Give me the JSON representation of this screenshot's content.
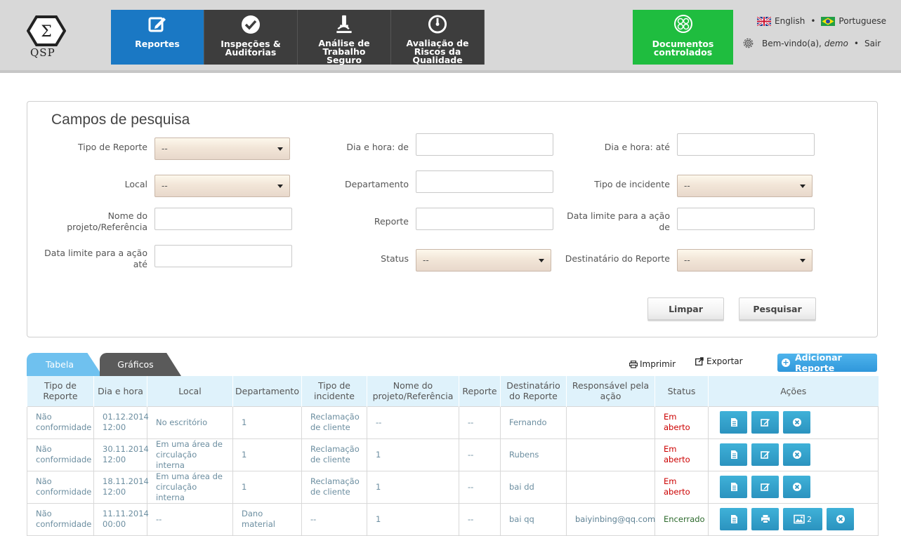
{
  "logo_text": "QSP",
  "nav": [
    {
      "label_1": "Reportes",
      "label_2": "",
      "label_3": "",
      "active": true,
      "icon": "edit-icon"
    },
    {
      "label_1": "Inspeções &",
      "label_2": "Auditorias",
      "label_3": "",
      "active": false,
      "icon": "check-circle-icon"
    },
    {
      "label_1": "Análise de",
      "label_2": "Trabalho",
      "label_3": "Seguro",
      "active": false,
      "icon": "microscope-icon"
    },
    {
      "label_1": "Avaliação de",
      "label_2": "Riscos da",
      "label_3": "Qualidade",
      "active": false,
      "icon": "gauge-icon"
    }
  ],
  "docs": {
    "line1": "Documentos",
    "line2": "controlados"
  },
  "lang": {
    "english": "English",
    "portuguese": "Portuguese",
    "dot": "•"
  },
  "user": {
    "welcome": "Bem-vindo(a),",
    "name": "demo",
    "logout": "Sair"
  },
  "search": {
    "title": "Campos de pesquisa",
    "tipo_reporte": "Tipo de Reporte",
    "dia_hora_de": "Dia e hora: de",
    "dia_hora_ate": "Dia e hora: até",
    "local": "Local",
    "departamento": "Departamento",
    "tipo_incidente": "Tipo de incidente",
    "nome_projeto_1": "Nome do",
    "nome_projeto_2": "projeto/Referência",
    "reporte": "Reporte",
    "data_limite_de_1": "Data limite para a ação",
    "data_limite_de_2": "de",
    "data_limite_ate_1": "Data limite para a ação",
    "data_limite_ate_2": "até",
    "status": "Status",
    "destinatario": "Destinatário do Reporte",
    "select_default": "--",
    "clear": "Limpar",
    "search": "Pesquisar"
  },
  "tabs": {
    "table": "Tabela",
    "charts": "Gráficos"
  },
  "toolbar": {
    "print": "Imprimir",
    "export": "Exportar",
    "add": "Adicionar Reporte"
  },
  "table": {
    "headers": [
      {
        "l1": "Tipo de",
        "l2": "Reporte"
      },
      {
        "l1": "Dia e hora",
        "l2": ""
      },
      {
        "l1": "Local",
        "l2": ""
      },
      {
        "l1": "Departamento",
        "l2": ""
      },
      {
        "l1": "Tipo de",
        "l2": "incidente"
      },
      {
        "l1": "Nome do",
        "l2": "projeto/Referência"
      },
      {
        "l1": "Reporte",
        "l2": ""
      },
      {
        "l1": "Destinatário",
        "l2": "do Reporte"
      },
      {
        "l1": "Responsável pela",
        "l2": "ação"
      },
      {
        "l1": "Status",
        "l2": ""
      },
      {
        "l1": "Ações",
        "l2": ""
      }
    ],
    "rows": [
      {
        "tipo_1": "Não",
        "tipo_2": "conformidade",
        "data_1": "01.12.2014",
        "data_2": "12:00",
        "local_1": "No escritório",
        "local_2": "",
        "dep": "1",
        "inc_1": "Reclamação",
        "inc_2": "de cliente",
        "proj": "--",
        "rep": "--",
        "dest": "Fernando",
        "resp": "",
        "status_1": "Em",
        "status_2": "aberto"
      },
      {
        "tipo_1": "Não",
        "tipo_2": "conformidade",
        "data_1": "30.11.2014",
        "data_2": "12:00",
        "local_1": "Em uma área de",
        "local_2": "circulação interna",
        "dep": "1",
        "inc_1": "Reclamação",
        "inc_2": "de cliente",
        "proj": "1",
        "rep": "--",
        "dest": "Rubens",
        "resp": "",
        "status_1": "Em",
        "status_2": "aberto"
      },
      {
        "tipo_1": "Não",
        "tipo_2": "conformidade",
        "data_1": "18.11.2014",
        "data_2": "12:00",
        "local_1": "Em uma área de",
        "local_2": "circulação interna",
        "dep": "1",
        "inc_1": "Reclamação",
        "inc_2": "de cliente",
        "proj": "1",
        "rep": "--",
        "dest": "bai dd",
        "resp": "",
        "status_1": "Em",
        "status_2": "aberto"
      },
      {
        "tipo_1": "Não",
        "tipo_2": "conformidade",
        "data_1": "11.11.2014",
        "data_2": "00:00",
        "local_1": "--",
        "local_2": "",
        "dep": "Dano material",
        "inc_1": "--",
        "inc_2": "",
        "proj": "1",
        "rep": "--",
        "dest": "bai qq",
        "resp": "baiyinbing@qq.com",
        "status_1": "Encerrado",
        "status_2": "",
        "image_count": "2"
      }
    ]
  },
  "colors": {
    "nav_active": "#1a78c4",
    "nav_bg": "#3d3d3d",
    "docs_bg": "#1fbd3f",
    "status_open": "#cc0000",
    "status_closed": "#2d6a2d",
    "action_btn": "#2b93bf"
  }
}
